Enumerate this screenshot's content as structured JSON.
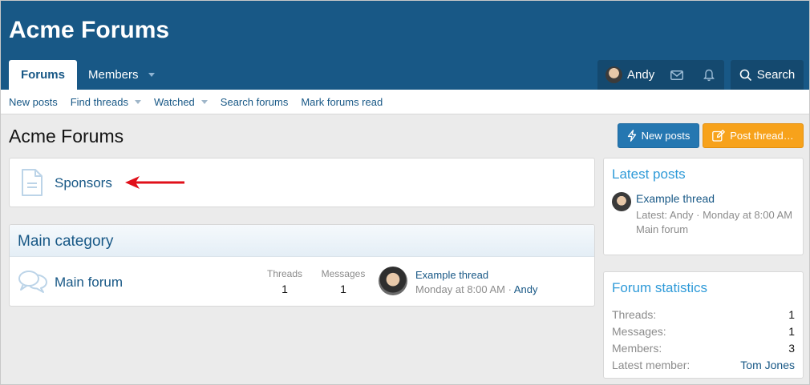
{
  "header": {
    "logo": "Acme Forums",
    "tabs": [
      {
        "label": "Forums",
        "active": true
      },
      {
        "label": "Members",
        "active": false
      }
    ],
    "user": {
      "name": "Andy"
    },
    "icons": [
      "mail-icon",
      "bell-icon"
    ],
    "search_label": "Search"
  },
  "subnav": {
    "items": [
      {
        "label": "New posts",
        "dropdown": false
      },
      {
        "label": "Find threads",
        "dropdown": true
      },
      {
        "label": "Watched",
        "dropdown": true
      },
      {
        "label": "Search forums",
        "dropdown": false
      },
      {
        "label": "Mark forums read",
        "dropdown": false
      }
    ]
  },
  "page": {
    "title": "Acme Forums",
    "buttons": {
      "new_posts": "New posts",
      "post_thread": "Post thread…"
    }
  },
  "sponsors": {
    "label": "Sponsors"
  },
  "main_category": {
    "title": "Main category",
    "forum": {
      "name": "Main forum",
      "threads_label": "Threads",
      "threads": "1",
      "messages_label": "Messages",
      "messages": "1",
      "last_thread": "Example thread",
      "last_time": "Monday at 8:00 AM",
      "separator": "·",
      "last_user": "Andy"
    }
  },
  "latest_posts": {
    "title": "Latest posts",
    "thread": "Example thread",
    "meta_line": "Latest: Andy · Monday at 8:00 AM",
    "forum": "Main forum"
  },
  "forum_stats": {
    "title": "Forum statistics",
    "rows": [
      {
        "label": "Threads:",
        "value": "1"
      },
      {
        "label": "Messages:",
        "value": "1"
      },
      {
        "label": "Members:",
        "value": "3"
      },
      {
        "label": "Latest member:",
        "value": "Tom Jones"
      }
    ]
  },
  "colors": {
    "header": "#185886",
    "accent": "#2577b1",
    "orange": "#f7a21b",
    "annotation_arrow": "#e0101a"
  }
}
